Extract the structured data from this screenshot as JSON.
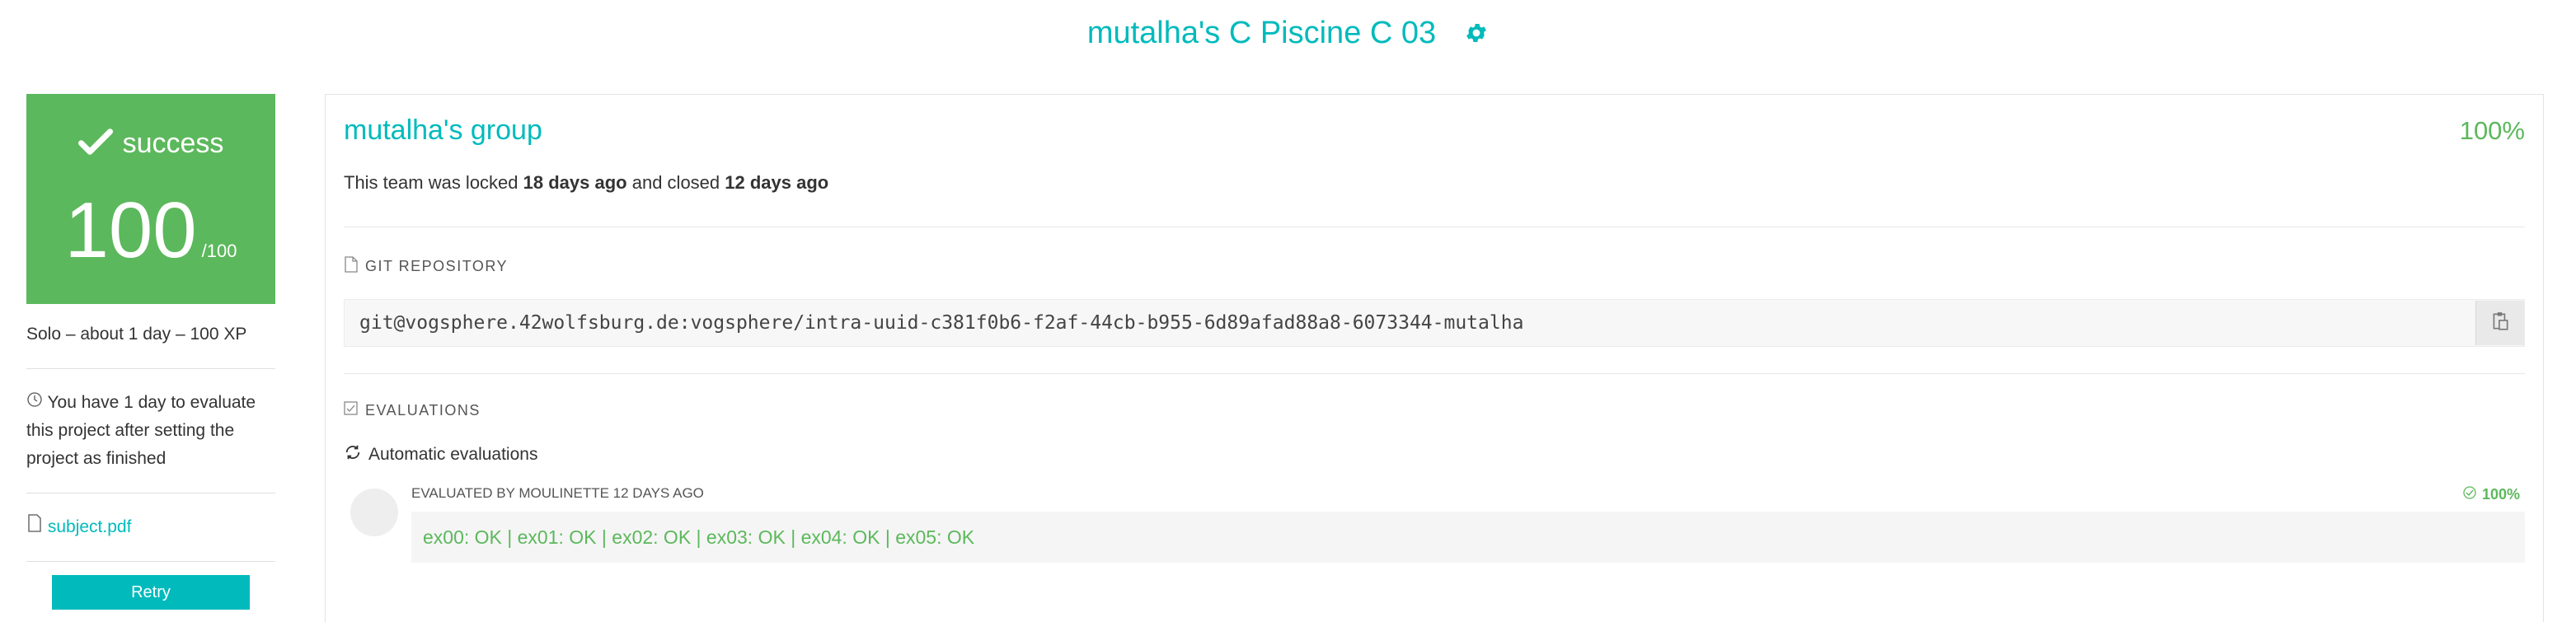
{
  "page": {
    "title": "mutalha's C Piscine C 03",
    "settings_icon": "gear-icon"
  },
  "sidebar": {
    "status": {
      "icon": "checkmark-icon",
      "label": "success",
      "grade": "100",
      "grade_max": "/100"
    },
    "meta": "Solo – about 1 day – 100 XP",
    "evaluation_note": "You have 1 day to evaluate this project after setting the project as finished",
    "subject_link": "subject.pdf",
    "retry_label": "Retry"
  },
  "team": {
    "name": "mutalha's group",
    "percent": "100%",
    "lock_prefix": "This team was locked",
    "locked_ago": "18 days ago",
    "lock_middle": "and closed",
    "closed_ago": "12 days ago"
  },
  "git": {
    "section_label": "GIT REPOSITORY",
    "url": "git@vogsphere.42wolfsburg.de:vogsphere/intra-uuid-c381f0b6-f2af-44cb-b955-6d89afad88a8-6073344-mutalha"
  },
  "evaluations": {
    "section_label": "EVALUATIONS",
    "automatic_label": "Automatic evaluations",
    "items": [
      {
        "evaluator": "EVALUATED BY MOULINETTE 12 DAYS AGO",
        "score": "100%",
        "output": "ex00: OK | ex01: OK | ex02: OK | ex03: OK | ex04: OK | ex05: OK"
      }
    ]
  },
  "colors": {
    "accent": "#00babc",
    "success": "#5cb85c"
  }
}
